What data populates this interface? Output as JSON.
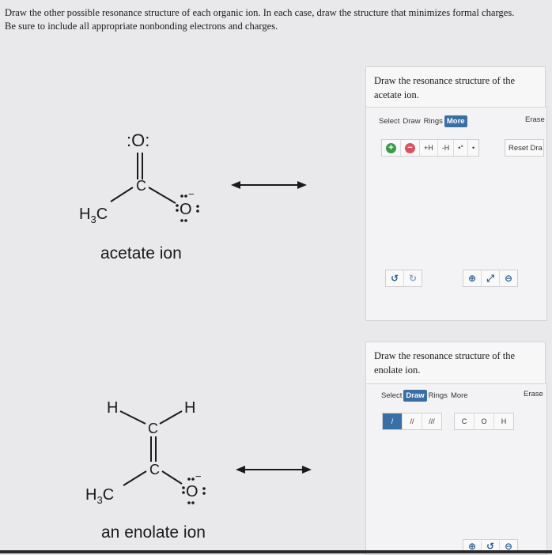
{
  "instructions": {
    "line1": "Draw the other possible resonance structure of each organic ion. In each case, draw the structure that minimizes formal charges.",
    "line2": "Be sure to include all appropriate nonbonding electrons and charges."
  },
  "acetate": {
    "caption": "acetate ion",
    "o_top": ":O:",
    "c": "C",
    "h3c": "H",
    "h3c_sub": "3",
    "h3c_c": "C",
    "o_minus": "O",
    "charge": "−"
  },
  "enolate": {
    "caption": "an enolate ion",
    "h_left": "H",
    "h_right": "H",
    "c_top": "C",
    "c_bottom": "C",
    "h3c": "H",
    "h3c_sub": "3",
    "h3c_c": "C",
    "o_minus": "O",
    "charge": "−"
  },
  "panel1": {
    "prompt": "Draw the resonance structure of the acetate ion.",
    "menu": [
      "Select",
      "Draw",
      "Rings",
      "More"
    ],
    "active_menu": "More",
    "erase": "Erase",
    "tools": [
      "+H",
      "-H"
    ],
    "reset": "Reset Dra"
  },
  "panel2": {
    "prompt": "Draw the resonance structure of the enolate ion.",
    "menu": [
      "Select",
      "Draw",
      "Rings",
      "More"
    ],
    "active_menu": "Draw",
    "erase": "Erase",
    "atoms": [
      "C",
      "O",
      "H"
    ]
  }
}
